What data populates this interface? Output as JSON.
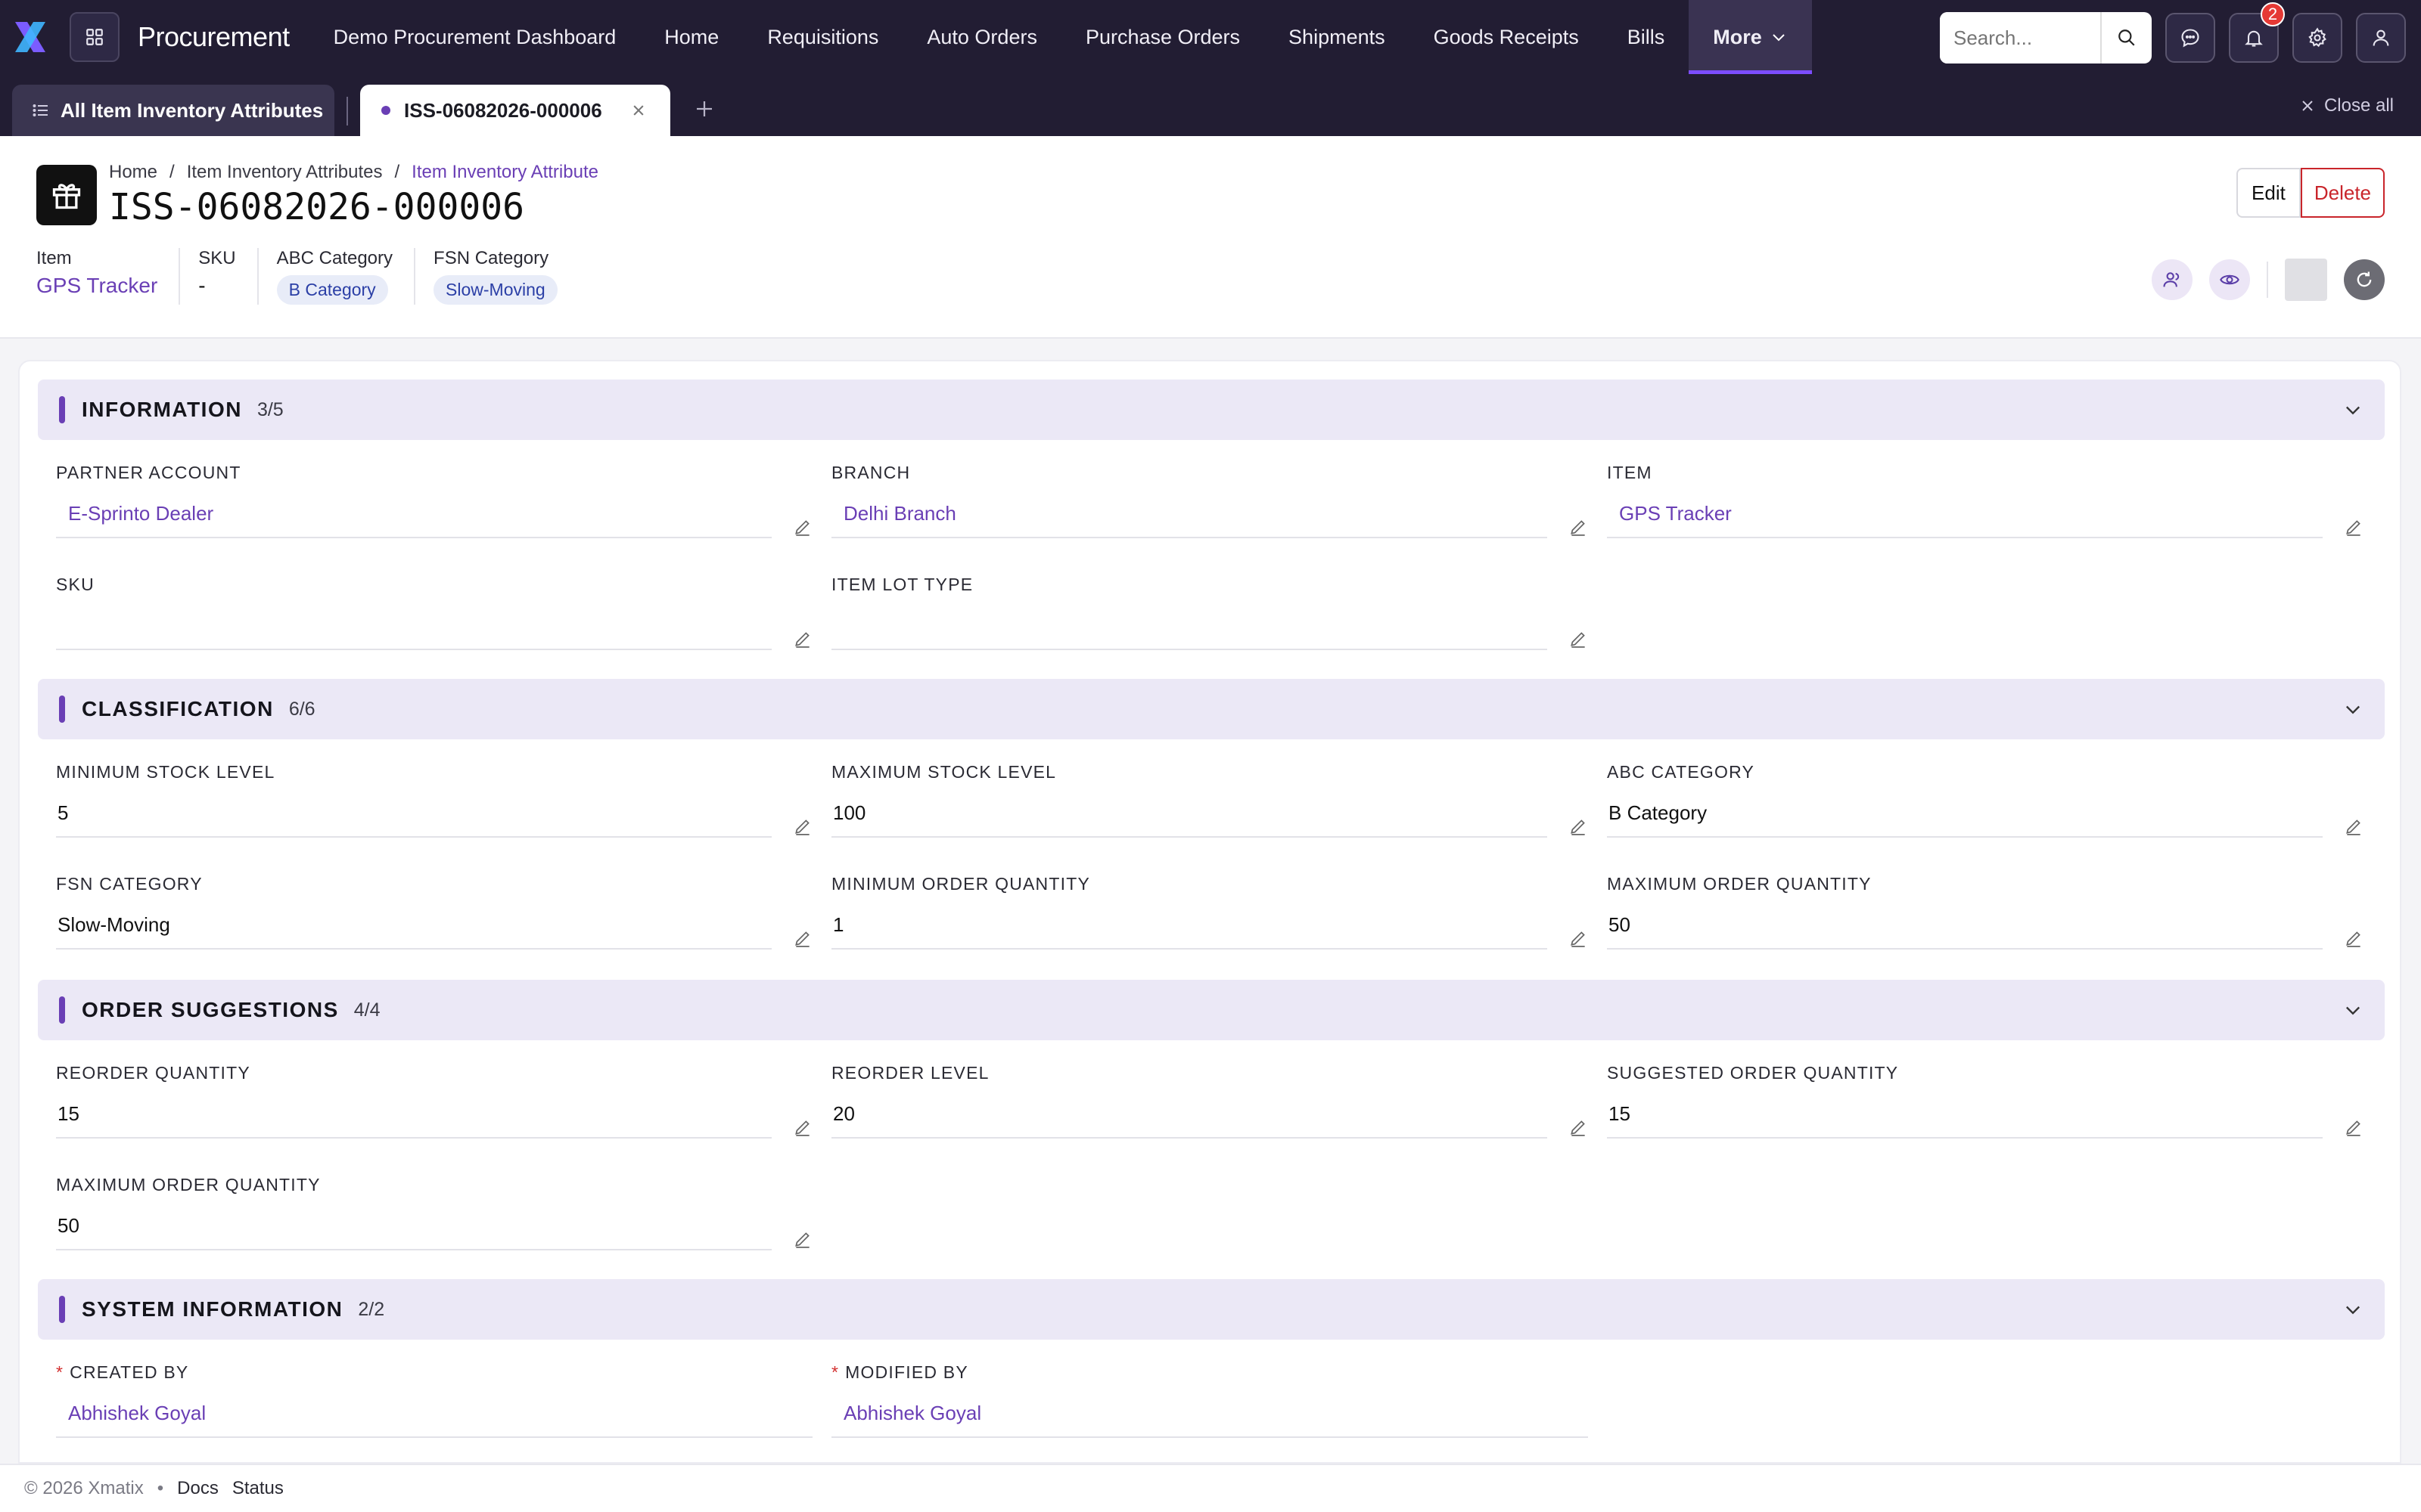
{
  "app": {
    "name": "Procurement",
    "colors": {
      "accent": "#6a3fb5",
      "nav_bg": "#221d33",
      "danger": "#c9252b"
    }
  },
  "nav": {
    "items": [
      "Demo Procurement Dashboard",
      "Home",
      "Requisitions",
      "Auto Orders",
      "Purchase Orders",
      "Shipments",
      "Goods Receipts",
      "Bills"
    ],
    "more_label": "More",
    "search_placeholder": "Search...",
    "notification_count": "2"
  },
  "tabs": {
    "list_tab": "All Item Inventory Attributes",
    "active_tab": "ISS-06082026-000006",
    "close_all": "Close all"
  },
  "header": {
    "breadcrumb": [
      "Home",
      "Item Inventory Attributes",
      "Item Inventory Attribute"
    ],
    "breadcrumb_sep": "/",
    "title": "ISS-06082026-000006",
    "edit_label": "Edit",
    "delete_label": "Delete",
    "summary": {
      "item_label": "Item",
      "item_value": "GPS Tracker",
      "sku_label": "SKU",
      "sku_value": "-",
      "abc_label": "ABC Category",
      "abc_value": "B Category",
      "fsn_label": "FSN Category",
      "fsn_value": "Slow-Moving"
    }
  },
  "sections": {
    "information": {
      "title": "INFORMATION",
      "count": "3/5",
      "fields": {
        "partner_account": {
          "label": "PARTNER ACCOUNT",
          "value": "E-Sprinto Dealer"
        },
        "branch": {
          "label": "BRANCH",
          "value": "Delhi Branch"
        },
        "item": {
          "label": "ITEM",
          "value": "GPS Tracker"
        },
        "sku": {
          "label": "SKU",
          "value": ""
        },
        "item_lot_type": {
          "label": "ITEM LOT TYPE",
          "value": ""
        }
      }
    },
    "classification": {
      "title": "CLASSIFICATION",
      "count": "6/6",
      "fields": {
        "min_stock": {
          "label": "MINIMUM STOCK LEVEL",
          "value": "5"
        },
        "max_stock": {
          "label": "MAXIMUM STOCK LEVEL",
          "value": "100"
        },
        "abc": {
          "label": "ABC CATEGORY",
          "value": "B Category"
        },
        "fsn": {
          "label": "FSN CATEGORY",
          "value": "Slow-Moving"
        },
        "min_order": {
          "label": "MINIMUM ORDER QUANTITY",
          "value": "1"
        },
        "max_order": {
          "label": "MAXIMUM ORDER QUANTITY",
          "value": "50"
        }
      }
    },
    "order_suggestions": {
      "title": "ORDER SUGGESTIONS",
      "count": "4/4",
      "fields": {
        "reorder_qty": {
          "label": "REORDER QUANTITY",
          "value": "15"
        },
        "reorder_level": {
          "label": "REORDER LEVEL",
          "value": "20"
        },
        "suggested_qty": {
          "label": "SUGGESTED ORDER QUANTITY",
          "value": "15"
        },
        "max_order": {
          "label": "MAXIMUM ORDER QUANTITY",
          "value": "50"
        }
      }
    },
    "system_information": {
      "title": "SYSTEM INFORMATION",
      "count": "2/2",
      "fields": {
        "created_by": {
          "label": "CREATED BY",
          "value": "Abhishek Goyal"
        },
        "modified_by": {
          "label": "MODIFIED BY",
          "value": "Abhishek Goyal"
        }
      }
    }
  },
  "footer": {
    "copyright": "© 2026 Xmatix",
    "dot": "•",
    "docs": "Docs",
    "status": "Status"
  }
}
